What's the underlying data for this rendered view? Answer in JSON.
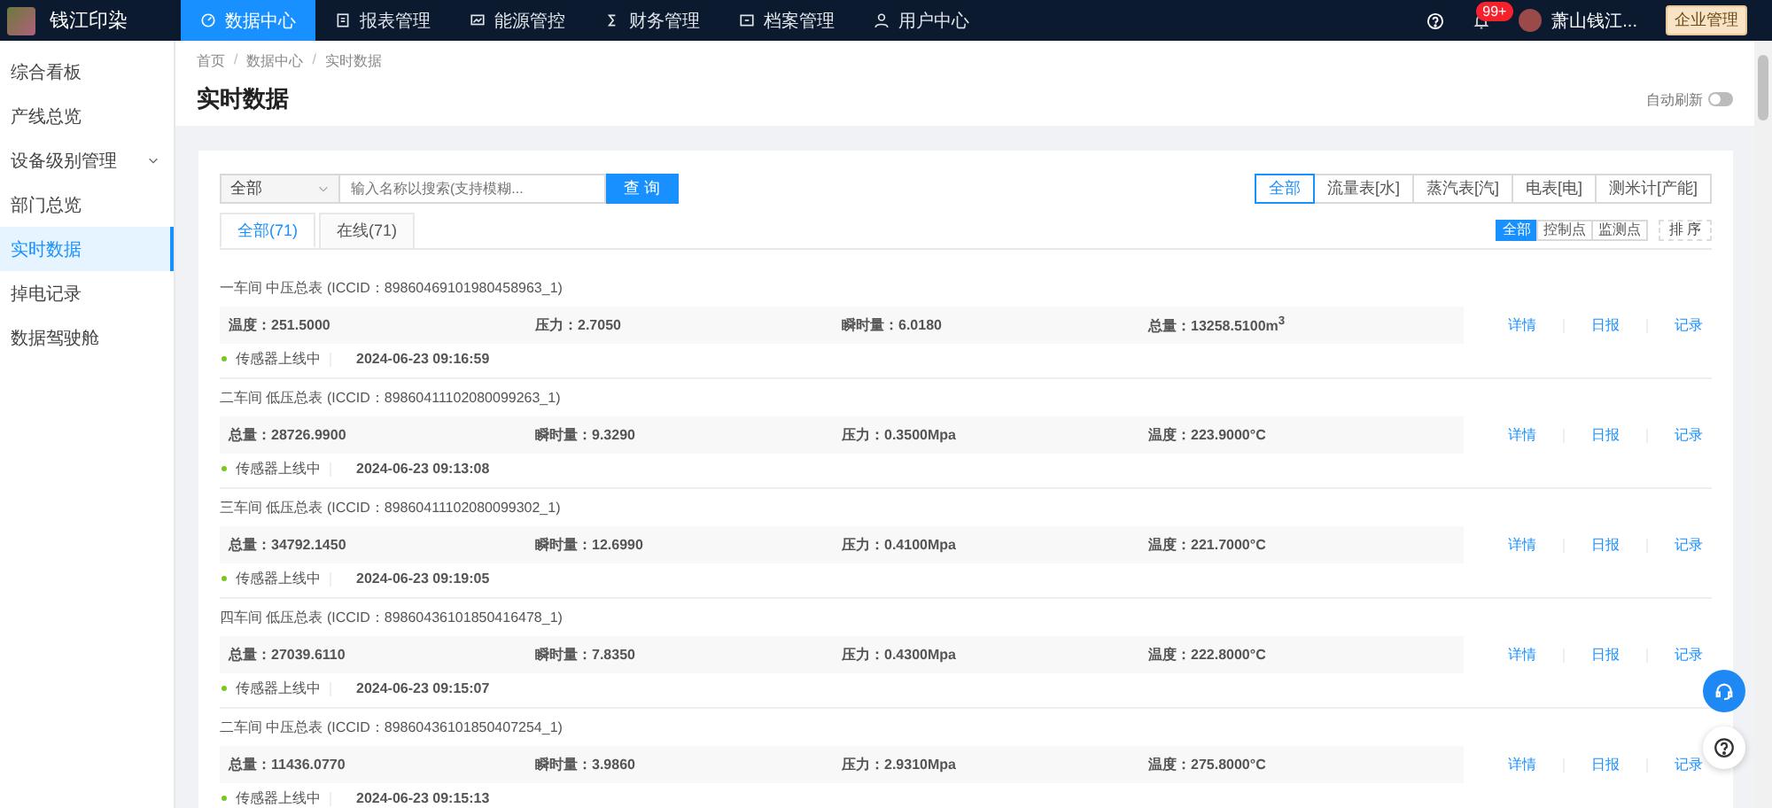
{
  "top_bar": {
    "logo_text": "钱江印染",
    "nav": [
      {
        "label": "数据中心",
        "selected": true
      },
      {
        "label": "报表管理",
        "selected": false
      },
      {
        "label": "能源管控",
        "selected": false
      },
      {
        "label": "财务管理",
        "selected": false
      },
      {
        "label": "档案管理",
        "selected": false
      },
      {
        "label": "用户中心",
        "selected": false
      }
    ],
    "notification_badge": "99+",
    "user_name": "萧山钱江...",
    "enterprise_button": "企业管理"
  },
  "sidebar": {
    "items": [
      {
        "label": "综合看板",
        "selected": false,
        "expandable": false
      },
      {
        "label": "产线总览",
        "selected": false,
        "expandable": false
      },
      {
        "label": "设备级别管理",
        "selected": false,
        "expandable": true
      },
      {
        "label": "部门总览",
        "selected": false,
        "expandable": false
      },
      {
        "label": "实时数据",
        "selected": true,
        "expandable": false
      },
      {
        "label": "掉电记录",
        "selected": false,
        "expandable": false
      },
      {
        "label": "数据驾驶舱",
        "selected": false,
        "expandable": false
      }
    ]
  },
  "page_header": {
    "breadcrumb": [
      "首页",
      "/",
      "数据中心",
      "/",
      "实时数据"
    ],
    "title": "实时数据",
    "auto_refresh": {
      "label": "自动刷新",
      "on": false
    }
  },
  "filters": {
    "category_select": "全部",
    "search": {
      "placeholder": "输入名称以搜索(支持模糊..."
    },
    "query_button": "查 询",
    "meter_types": [
      {
        "label": "全部",
        "selected": true
      },
      {
        "label": "流量表[水]",
        "selected": false
      },
      {
        "label": "蒸汽表[汽]",
        "selected": false
      },
      {
        "label": "电表[电]",
        "selected": false
      },
      {
        "label": "测米计[产能]",
        "selected": false
      }
    ],
    "status_tabs": [
      {
        "label": "全部(71)",
        "selected": true
      },
      {
        "label": "在线(71)",
        "selected": false
      }
    ],
    "point_types": [
      {
        "label": "全部",
        "selected": true
      },
      {
        "label": "控制点",
        "selected": false
      },
      {
        "label": "监测点",
        "selected": false
      }
    ],
    "sort_button": "排 序"
  },
  "records": [
    {
      "title": "一车间 中压总表 (ICCID：89860469101980458963_1)",
      "metrics": [
        "温度：251.5000",
        "压力：2.7050",
        "瞬时量：6.0180",
        "总量：13258.5100m$^{3}$"
      ],
      "status": {
        "label": "传感器上线中",
        "online": true
      },
      "time": "2024-06-23 09:16:59",
      "actions": [
        "详情",
        "日报",
        "记录"
      ]
    },
    {
      "title": "二车间 低压总表 (ICCID：89860411102080099263_1)",
      "metrics": [
        "总量：28726.9900",
        "瞬时量：9.3290",
        "压力：0.3500Mpa",
        "温度：223.9000°C"
      ],
      "status": {
        "label": "传感器上线中",
        "online": true
      },
      "time": "2024-06-23 09:13:08",
      "actions": [
        "详情",
        "日报",
        "记录"
      ]
    },
    {
      "title": "三车间 低压总表 (ICCID：89860411102080099302_1)",
      "metrics": [
        "总量：34792.1450",
        "瞬时量：12.6990",
        "压力：0.4100Mpa",
        "温度：221.7000°C"
      ],
      "status": {
        "label": "传感器上线中",
        "online": true
      },
      "time": "2024-06-23 09:19:05",
      "actions": [
        "详情",
        "日报",
        "记录"
      ]
    },
    {
      "title": "四车间 低压总表 (ICCID：89860436101850416478_1)",
      "metrics": [
        "总量：27039.6110",
        "瞬时量：7.8350",
        "压力：0.4300Mpa",
        "温度：222.8000°C"
      ],
      "status": {
        "label": "传感器上线中",
        "online": true
      },
      "time": "2024-06-23 09:15:07",
      "actions": [
        "详情",
        "日报",
        "记录"
      ]
    },
    {
      "title": "二车间 中压总表 (ICCID：89860436101850407254_1)",
      "metrics": [
        "总量：11436.0770",
        "瞬时量：3.9860",
        "压力：2.9310Mpa",
        "温度：275.8000°C"
      ],
      "status": {
        "label": "传感器上线中",
        "online": true
      },
      "time": "2024-06-23 09:15:13",
      "actions": [
        "详情",
        "日报",
        "记录"
      ]
    }
  ]
}
